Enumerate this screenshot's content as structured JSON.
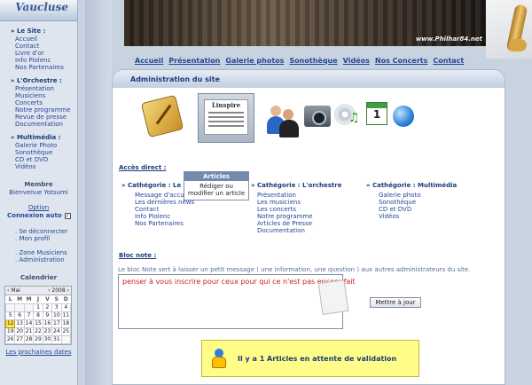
{
  "logo": {
    "text": "Vaucluse"
  },
  "sidebar": {
    "site_title": "» Le Site :",
    "site_items": [
      "Accueil",
      "Contact",
      "Livre d'or",
      "Info Piolenc",
      "Nos Partenaires"
    ],
    "orch_title": "» L'Orchestre :",
    "orch_items": [
      "Présentation",
      "Musiciens",
      "Concerts",
      "Notre programme",
      "Revue de presse",
      "Documentation"
    ],
    "multi_title": "» Multimédia :",
    "multi_items": [
      "Galerie Photo",
      "Sonothèque",
      "CD et DVD",
      "Vidéos"
    ],
    "member_label": "Membre",
    "welcome": "Bienvenue Yotsumi",
    "option_link": "Option",
    "connexion_auto": "Connexion auto",
    "connexion_checked": "✓",
    "logout": "Se déconnecter",
    "profile": "Mon profil",
    "zone": "Zone Musiciens",
    "admin": "Administration",
    "calendar_title": "Calendrier",
    "footer_link": "Les prochaines dates"
  },
  "calendar": {
    "month": "Mai",
    "year": "2008",
    "dow": [
      "L",
      "M",
      "M",
      "J",
      "V",
      "S",
      "D"
    ],
    "rows": [
      [
        "",
        "",
        "",
        "1",
        "2",
        "3",
        "4"
      ],
      [
        "5",
        "6",
        "7",
        "8",
        "9",
        "10",
        "11"
      ],
      [
        "12",
        "13",
        "14",
        "15",
        "16",
        "17",
        "18"
      ],
      [
        "19",
        "20",
        "21",
        "22",
        "23",
        "24",
        "25"
      ],
      [
        "26",
        "27",
        "28",
        "29",
        "30",
        "31",
        ""
      ]
    ],
    "today": "12"
  },
  "banner": {
    "url": "www.Philhar84.net"
  },
  "topnav": [
    "Accueil",
    "Présentation",
    "Galerie photos",
    "Sonothèque",
    "Vidéos",
    "Nos Concerts",
    "Contact"
  ],
  "main": {
    "title": "Administration du site",
    "news_icon_label": "Linspire",
    "calendar_icon_num": "1",
    "acces_direct": "Accès direct :",
    "cat1_title": "» Cathégorie : Le site",
    "cat1_items": [
      "Message d'accueil",
      "Les dernières news",
      "Contact",
      "Info Piolenc",
      "Nos Partenaires"
    ],
    "cat2_title": "» Cathégorie : L'orchestre",
    "cat2_items": [
      "Présentation",
      "Les musiciens",
      "Les concerts",
      "Notre programme",
      "Articles de Presse",
      "Documentation"
    ],
    "cat3_title": "» Cathégorie : Multimédia",
    "cat3_items": [
      "Galerie photo",
      "Sonothèque",
      "CD et DVD",
      "Vidéos"
    ],
    "tooltip_title": "Articles",
    "tooltip_line1": "Rédiger ou",
    "tooltip_line2": "modifier un article",
    "bloc_note": "Bloc note :",
    "bloc_desc": "Le bloc Note sert à laisser un petit message ( une information, une question ) aux autres administrateurs du site.",
    "note_text": "penser à vous inscrire pour ceux pour qui ce n'est pas encore fait",
    "save_button": "Mettre à jour",
    "alert_text": "Il y a 1 Articles en attente de validation"
  },
  "colors": {
    "sidebar_bg": "#dfe5ee",
    "link": "#23479a",
    "alert_bg": "#fffc88",
    "note_text": "#cc1a1a",
    "today": "#ffe34a"
  }
}
